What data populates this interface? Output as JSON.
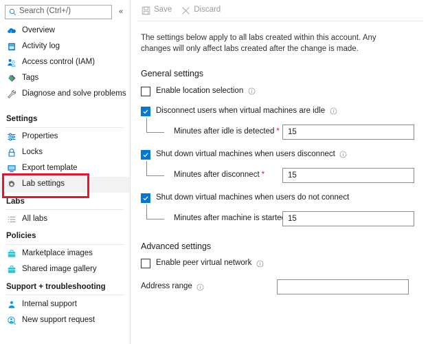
{
  "sidebar": {
    "search": {
      "placeholder": "Search (Ctrl+/)",
      "icon": "search-icon"
    },
    "collapse_label": "«",
    "top_items": [
      {
        "label": "Overview",
        "icon": "cloud-icon"
      },
      {
        "label": "Activity log",
        "icon": "activity-log-icon"
      },
      {
        "label": "Access control (IAM)",
        "icon": "access-control-icon"
      },
      {
        "label": "Tags",
        "icon": "tag-icon"
      },
      {
        "label": "Diagnose and solve problems",
        "icon": "wrench-icon"
      }
    ],
    "groups": [
      {
        "title": "Settings",
        "items": [
          {
            "label": "Properties",
            "icon": "properties-icon",
            "selected": false
          },
          {
            "label": "Locks",
            "icon": "lock-icon",
            "selected": false
          },
          {
            "label": "Export template",
            "icon": "export-template-icon",
            "selected": false
          },
          {
            "label": "Lab settings",
            "icon": "gear-icon",
            "selected": true
          }
        ]
      },
      {
        "title": "Labs",
        "items": [
          {
            "label": "All labs",
            "icon": "list-icon",
            "selected": false
          }
        ]
      },
      {
        "title": "Policies",
        "items": [
          {
            "label": "Marketplace images",
            "icon": "briefcase-icon",
            "selected": false
          },
          {
            "label": "Shared image gallery",
            "icon": "briefcase-icon",
            "selected": false
          }
        ]
      },
      {
        "title": "Support + troubleshooting",
        "items": [
          {
            "label": "Internal support",
            "icon": "person-support-icon",
            "selected": false
          },
          {
            "label": "New support request",
            "icon": "new-support-request-icon",
            "selected": false
          }
        ]
      }
    ]
  },
  "toolbar": {
    "save_label": "Save",
    "discard_label": "Discard"
  },
  "main": {
    "intro": "The settings below apply to all labs created within this account. Any changes will only affect labs created after the change is made.",
    "general_title": "General settings",
    "advanced_title": "Advanced settings",
    "general": {
      "enable_location": {
        "label": "Enable location selection",
        "checked": false,
        "has_info": true
      },
      "disconnect_idle": {
        "label": "Disconnect users when virtual machines are idle",
        "checked": true,
        "has_info": true,
        "sub_label": "Minutes after idle is detected",
        "sub_required": "*",
        "sub_value": "15"
      },
      "shutdown_disconnect": {
        "label": "Shut down virtual machines when users disconnect",
        "checked": true,
        "has_info": true,
        "sub_label": "Minutes after disconnect",
        "sub_required": "*",
        "sub_value": "15"
      },
      "shutdown_no_connect": {
        "label": "Shut down virtual machines when users do not connect",
        "checked": true,
        "has_info": false,
        "sub_label": "Minutes after machine is started",
        "sub_required": "*",
        "sub_value": "15"
      }
    },
    "advanced": {
      "peer_vnet": {
        "label": "Enable peer virtual network",
        "checked": false,
        "has_info": true
      },
      "address_range": {
        "label": "Address range",
        "has_info": true,
        "value": "",
        "placeholder": ""
      }
    }
  },
  "annotation": {
    "color": "#e8142d",
    "target": "Lab settings"
  },
  "colors": {
    "accent": "#0078d4",
    "required": "#e81123",
    "annotation": "#e8142d",
    "selected_row": "#f2f2f2"
  }
}
